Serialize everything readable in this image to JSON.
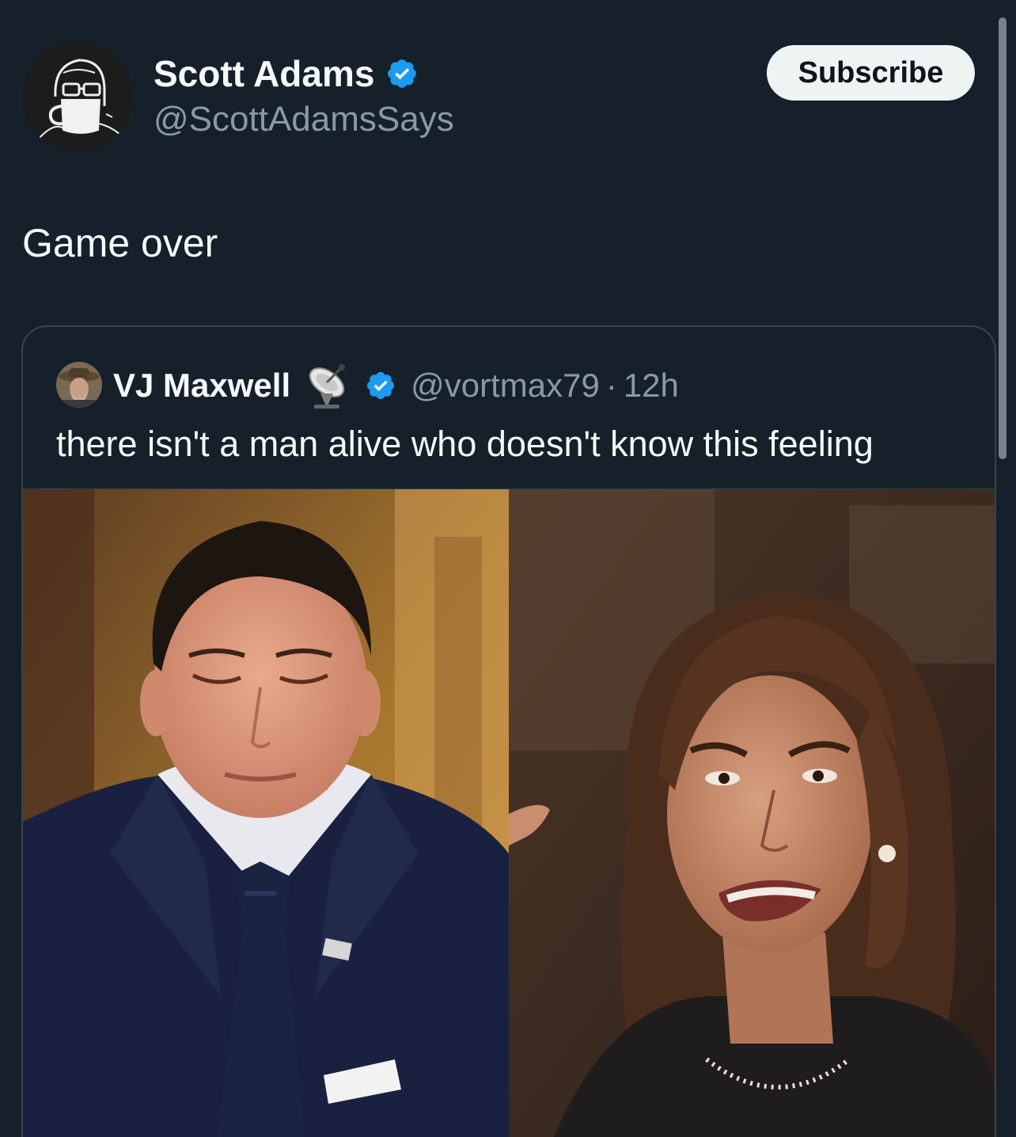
{
  "tweet": {
    "author": {
      "name": "Scott Adams",
      "handle": "@ScottAdamsSays",
      "verified": true,
      "avatar_icon": "cartoon-mug-avatar"
    },
    "subscribe_label": "Subscribe",
    "text": "Game over"
  },
  "quoted_tweet": {
    "author": {
      "name": "VJ Maxwell",
      "emoji": "📡",
      "verified": true,
      "handle": "@vortmax79",
      "separator": "·",
      "time": "12h"
    },
    "text": "there isn't a man alive who doesn't know this feeling",
    "media": [
      {
        "name": "photo-man-eyes-closed"
      },
      {
        "name": "photo-woman-speaking"
      }
    ]
  },
  "colors": {
    "background": "#15202b",
    "verified_blue": "#1d9bf0",
    "secondary_text": "#8b98a5",
    "border": "#38444d"
  }
}
